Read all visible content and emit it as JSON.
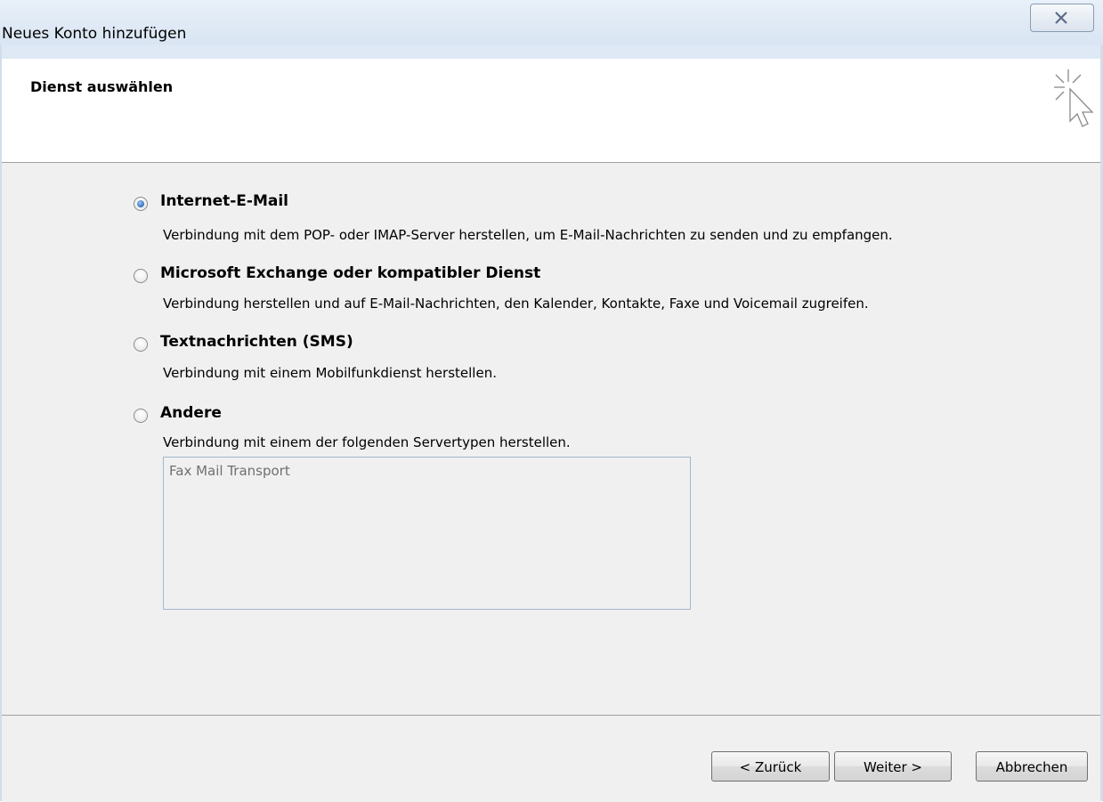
{
  "window": {
    "title": "Neues Konto hinzufügen"
  },
  "header": {
    "title": "Dienst auswählen"
  },
  "options": [
    {
      "label": "Internet-E-Mail",
      "description": "Verbindung mit dem POP- oder IMAP-Server herstellen, um E-Mail-Nachrichten zu senden und zu empfangen.",
      "selected": true
    },
    {
      "label": "Microsoft Exchange oder kompatibler Dienst",
      "description": "Verbindung herstellen und auf E-Mail-Nachrichten, den Kalender, Kontakte, Faxe und Voicemail zugreifen.",
      "selected": false
    },
    {
      "label": "Textnachrichten (SMS)",
      "description": "Verbindung mit einem Mobilfunkdienst herstellen.",
      "selected": false
    },
    {
      "label": "Andere",
      "description": "Verbindung mit einem der folgenden Servertypen herstellen.",
      "selected": false
    }
  ],
  "server_types": {
    "items": [
      "Fax Mail Transport"
    ]
  },
  "buttons": {
    "back": "< Zurück",
    "next": "Weiter >",
    "cancel": "Abbrechen"
  },
  "icons": {
    "close": "close-icon",
    "wizard": "cursor-sparkle-icon"
  }
}
